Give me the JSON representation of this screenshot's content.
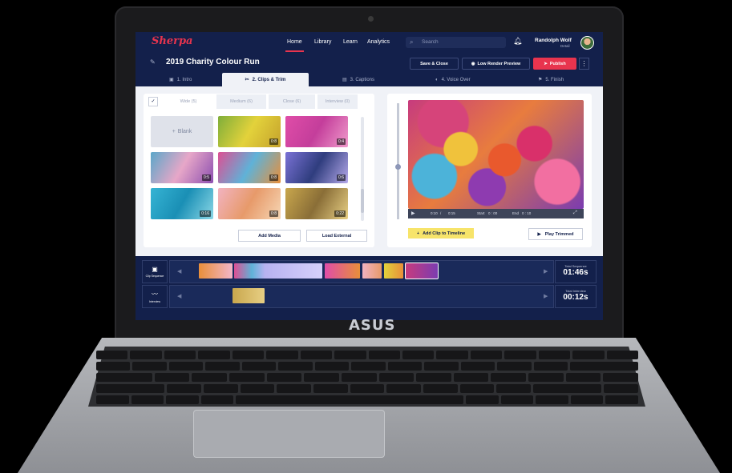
{
  "device": {
    "brand": "ASUS"
  },
  "nav": {
    "logo": "Sherpa",
    "links": [
      "Home",
      "Library",
      "Learn",
      "Analytics"
    ],
    "search_placeholder": "Search",
    "user_name": "Randolph Wolf",
    "user_role": "Detail"
  },
  "project": {
    "title": "2019 Charity Colour Run",
    "save_close": "Save & Close",
    "low_render": "Low Render Preview",
    "publish": "Publish"
  },
  "steps": [
    "1. Intro",
    "2. Clips & Trim",
    "3. Captions",
    "4. Voice Over",
    "5. Finish"
  ],
  "clips_panel": {
    "tabs": [
      "Wide (5)",
      "Medium (6)",
      "Close (6)",
      "Interview (0)"
    ],
    "blank_label": "Blank",
    "durations": [
      "0:8",
      "0:4",
      "0:5",
      "0:8",
      "0:6",
      "0:16",
      "0:8",
      "0:22"
    ],
    "add_media": "Add Media",
    "load_external": "Load External"
  },
  "preview": {
    "time_current": "0:10",
    "time_total": "0:15",
    "start_label": "Start",
    "start_value": "0 : 00",
    "end_label": "End",
    "end_value": "0 : 10",
    "add_clip": "Add Clip to Timeline",
    "play_trimmed": "Play Trimmed"
  },
  "timeline": {
    "clip_label": "Clip Sequence",
    "interview_label": "Interview",
    "total_sequence_label": "Total Sequence",
    "total_sequence": "01:46s",
    "total_interview_label": "Total Interview",
    "total_interview": "00:12s"
  },
  "colors": {
    "navy": "#13204b",
    "accent": "#e8344e",
    "highlight": "#f7e46a"
  }
}
